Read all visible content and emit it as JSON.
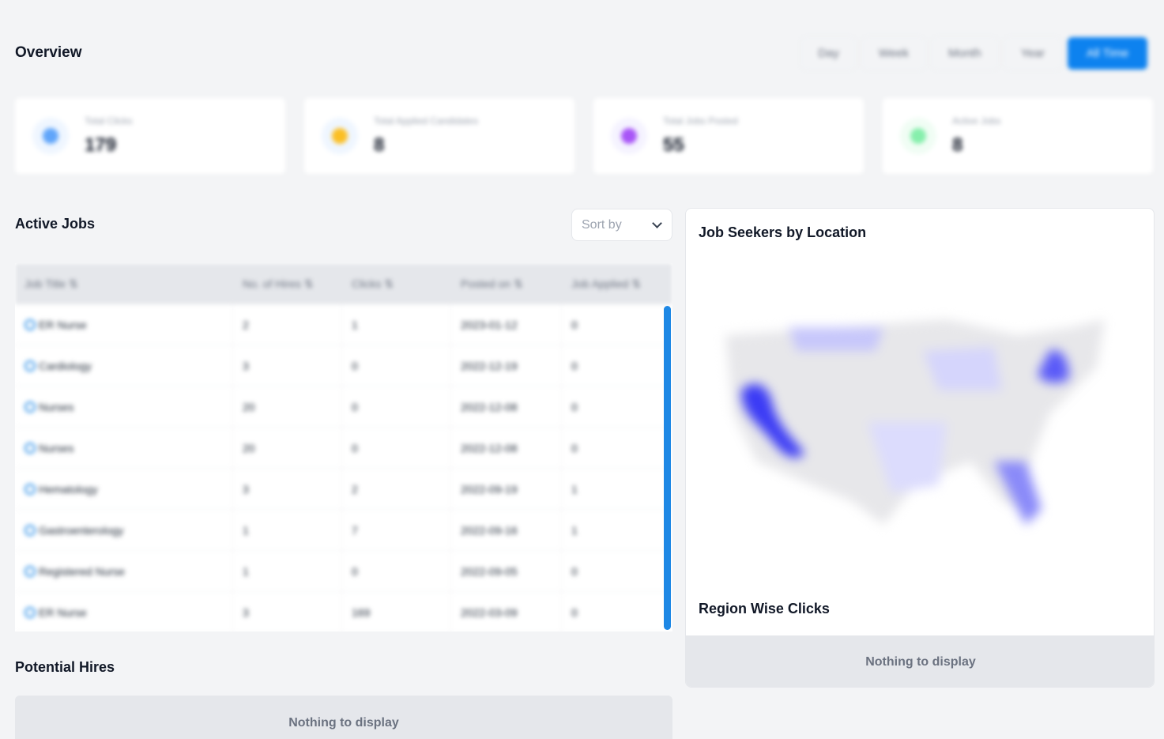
{
  "overview": {
    "title": "Overview",
    "ranges": [
      {
        "label": "Day",
        "active": false
      },
      {
        "label": "Week",
        "active": false
      },
      {
        "label": "Month",
        "active": false
      },
      {
        "label": "Year",
        "active": false
      },
      {
        "label": "All Time",
        "active": true
      }
    ]
  },
  "stats": [
    {
      "label": "Total Clicks",
      "value": "179",
      "icon": "cursor-icon",
      "color": "#3b82f6",
      "bg": "#eff6ff"
    },
    {
      "label": "Total Applied Candidates",
      "value": "8",
      "icon": "users-icon",
      "color": "#f59e0b",
      "bg": "#eff6ff"
    },
    {
      "label": "Total Jobs Posted",
      "value": "55",
      "icon": "briefcase-icon",
      "color": "#8b5cf6",
      "bg": "#f5f3ff"
    },
    {
      "label": "Active Jobs",
      "value": "8",
      "icon": "check-icon",
      "color": "#22c55e",
      "bg": "#f0fdf4"
    }
  ],
  "active_jobs": {
    "title": "Active Jobs",
    "sort_placeholder": "Sort by",
    "columns": [
      "Job Title ⇅",
      "No. of Hires ⇅",
      "Clicks ⇅",
      "Posted on ⇅",
      "Job Applied ⇅"
    ],
    "rows": [
      [
        "ER Nurse",
        "2",
        "1",
        "2023-01-12",
        "0"
      ],
      [
        "Cardiology",
        "3",
        "0",
        "2022-12-19",
        "0"
      ],
      [
        "Nurses",
        "20",
        "0",
        "2022-12-08",
        "0"
      ],
      [
        "Nurses",
        "20",
        "0",
        "2022-12-08",
        "0"
      ],
      [
        "Hematology",
        "3",
        "2",
        "2022-09-19",
        "1"
      ],
      [
        "Gastroenterology",
        "1",
        "7",
        "2022-09-16",
        "1"
      ],
      [
        "Registered Nurse",
        "1",
        "0",
        "2022-09-05",
        "0"
      ],
      [
        "ER Nurse",
        "3",
        "169",
        "2022-03-09",
        "0"
      ]
    ]
  },
  "location": {
    "title": "Job Seekers by Location",
    "region_title": "Region Wise Clicks",
    "empty": "Nothing to display"
  },
  "hires": {
    "title": "Potential Hires",
    "empty": "Nothing to display"
  }
}
